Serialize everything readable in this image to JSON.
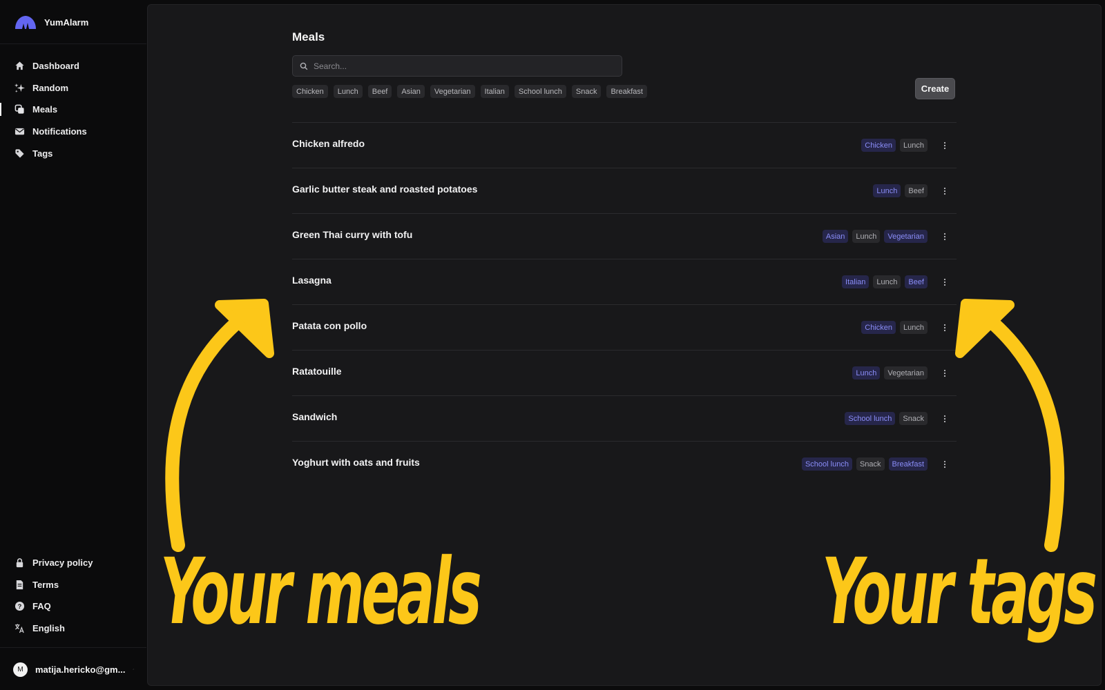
{
  "app": {
    "name": "YumAlarm"
  },
  "sidebar": {
    "items": [
      {
        "label": "Dashboard",
        "icon": "home-icon"
      },
      {
        "label": "Random",
        "icon": "sparkles-icon"
      },
      {
        "label": "Meals",
        "icon": "copy-icon",
        "active": true
      },
      {
        "label": "Notifications",
        "icon": "mail-icon"
      },
      {
        "label": "Tags",
        "icon": "tag-icon"
      }
    ],
    "bottom_items": [
      {
        "label": "Privacy policy",
        "icon": "lock-icon"
      },
      {
        "label": "Terms",
        "icon": "document-icon"
      },
      {
        "label": "FAQ",
        "icon": "help-icon"
      },
      {
        "label": "English",
        "icon": "translate-icon"
      }
    ],
    "user": {
      "initial": "M",
      "email": "matija.hericko@gm..."
    }
  },
  "main": {
    "title": "Meals",
    "search": {
      "placeholder": "Search...",
      "value": ""
    },
    "filters": [
      "Chicken",
      "Lunch",
      "Beef",
      "Asian",
      "Vegetarian",
      "Italian",
      "School lunch",
      "Snack",
      "Breakfast"
    ],
    "create_label": "Create",
    "meals": [
      {
        "title": "Chicken alfredo",
        "tags": [
          {
            "label": "Chicken",
            "style": "blue"
          },
          {
            "label": "Lunch",
            "style": "gray"
          }
        ]
      },
      {
        "title": "Garlic butter steak and roasted potatoes",
        "tags": [
          {
            "label": "Lunch",
            "style": "blue"
          },
          {
            "label": "Beef",
            "style": "gray"
          }
        ]
      },
      {
        "title": "Green Thai curry with tofu",
        "tags": [
          {
            "label": "Asian",
            "style": "blue"
          },
          {
            "label": "Lunch",
            "style": "gray"
          },
          {
            "label": "Vegetarian",
            "style": "blue"
          }
        ]
      },
      {
        "title": "Lasagna",
        "tags": [
          {
            "label": "Italian",
            "style": "blue"
          },
          {
            "label": "Lunch",
            "style": "gray"
          },
          {
            "label": "Beef",
            "style": "blue"
          }
        ]
      },
      {
        "title": "Patata con pollo",
        "tags": [
          {
            "label": "Chicken",
            "style": "blue"
          },
          {
            "label": "Lunch",
            "style": "gray"
          }
        ]
      },
      {
        "title": "Ratatouille",
        "tags": [
          {
            "label": "Lunch",
            "style": "blue"
          },
          {
            "label": "Vegetarian",
            "style": "gray"
          }
        ]
      },
      {
        "title": "Sandwich",
        "tags": [
          {
            "label": "School lunch",
            "style": "blue"
          },
          {
            "label": "Snack",
            "style": "gray"
          }
        ]
      },
      {
        "title": "Yoghurt with oats and fruits",
        "tags": [
          {
            "label": "School lunch",
            "style": "blue"
          },
          {
            "label": "Snack",
            "style": "gray"
          },
          {
            "label": "Breakfast",
            "style": "blue"
          }
        ]
      }
    ]
  },
  "annotations": {
    "left_text": "Your meals",
    "right_text": "Your tags",
    "color": "#fcc719"
  },
  "colors": {
    "accent": "#6366f1",
    "tag_blue_text": "#8a8df7",
    "panel_bg": "#18181a"
  }
}
